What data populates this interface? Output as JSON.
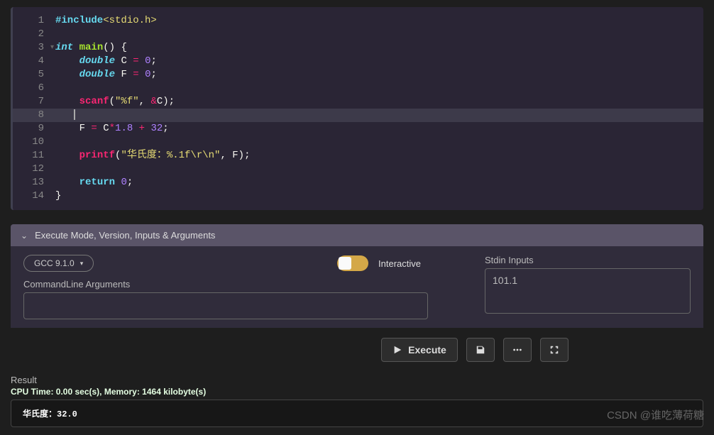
{
  "editor": {
    "lines": [
      {
        "n": 1,
        "fold": false,
        "tokens": [
          [
            "preproc",
            "#include"
          ],
          [
            "include",
            "<stdio.h>"
          ]
        ]
      },
      {
        "n": 2,
        "fold": false,
        "tokens": []
      },
      {
        "n": 3,
        "fold": true,
        "tokens": [
          [
            "type",
            "int"
          ],
          [
            "punct",
            " "
          ],
          [
            "funcname",
            "main"
          ],
          [
            "punct",
            "() {"
          ]
        ]
      },
      {
        "n": 4,
        "fold": false,
        "tokens": [
          [
            "punct",
            "    "
          ],
          [
            "type",
            "double"
          ],
          [
            "punct",
            " "
          ],
          [
            "var",
            "C"
          ],
          [
            "punct",
            " "
          ],
          [
            "op",
            "="
          ],
          [
            "punct",
            " "
          ],
          [
            "number",
            "0"
          ],
          [
            "punct",
            ";"
          ]
        ]
      },
      {
        "n": 5,
        "fold": false,
        "tokens": [
          [
            "punct",
            "    "
          ],
          [
            "type",
            "double"
          ],
          [
            "punct",
            " "
          ],
          [
            "var",
            "F"
          ],
          [
            "punct",
            " "
          ],
          [
            "op",
            "="
          ],
          [
            "punct",
            " "
          ],
          [
            "number",
            "0"
          ],
          [
            "punct",
            ";"
          ]
        ]
      },
      {
        "n": 6,
        "fold": false,
        "tokens": []
      },
      {
        "n": 7,
        "fold": false,
        "tokens": [
          [
            "punct",
            "    "
          ],
          [
            "func",
            "scanf"
          ],
          [
            "punct",
            "("
          ],
          [
            "string",
            "\"%f\""
          ],
          [
            "punct",
            ", "
          ],
          [
            "op",
            "&"
          ],
          [
            "var",
            "C"
          ],
          [
            "punct",
            ");"
          ]
        ]
      },
      {
        "n": 8,
        "fold": false,
        "tokens": [],
        "highlight": true,
        "cursor": true
      },
      {
        "n": 9,
        "fold": false,
        "tokens": [
          [
            "punct",
            "    "
          ],
          [
            "var",
            "F"
          ],
          [
            "punct",
            " "
          ],
          [
            "op",
            "="
          ],
          [
            "punct",
            " "
          ],
          [
            "var",
            "C"
          ],
          [
            "op",
            "*"
          ],
          [
            "number",
            "1.8"
          ],
          [
            "punct",
            " "
          ],
          [
            "op",
            "+"
          ],
          [
            "punct",
            " "
          ],
          [
            "number",
            "32"
          ],
          [
            "punct",
            ";"
          ]
        ]
      },
      {
        "n": 10,
        "fold": false,
        "tokens": []
      },
      {
        "n": 11,
        "fold": false,
        "tokens": [
          [
            "punct",
            "    "
          ],
          [
            "func",
            "printf"
          ],
          [
            "punct",
            "("
          ],
          [
            "string",
            "\"华氏度：%.1f\\r\\n\""
          ],
          [
            "punct",
            ", "
          ],
          [
            "var",
            "F"
          ],
          [
            "punct",
            ");"
          ]
        ]
      },
      {
        "n": 12,
        "fold": false,
        "tokens": []
      },
      {
        "n": 13,
        "fold": false,
        "tokens": [
          [
            "punct",
            "    "
          ],
          [
            "keyword",
            "return"
          ],
          [
            "punct",
            " "
          ],
          [
            "number",
            "0"
          ],
          [
            "punct",
            ";"
          ]
        ]
      },
      {
        "n": 14,
        "fold": false,
        "tokens": [
          [
            "punct",
            "}"
          ]
        ]
      }
    ]
  },
  "panel": {
    "title": "Execute Mode, Version, Inputs & Arguments",
    "compiler": "GCC 9.1.0",
    "interactive_label": "Interactive",
    "cmdline_label": "CommandLine Arguments",
    "cmdline_value": "",
    "stdin_label": "Stdin Inputs",
    "stdin_value": "101.1"
  },
  "toolbar": {
    "execute_label": "Execute"
  },
  "result": {
    "label": "Result",
    "stats": "CPU Time: 0.00 sec(s), Memory: 1464 kilobyte(s)",
    "output": "华氏度：32.0"
  },
  "watermark": "CSDN @谁吃薄荷糖"
}
